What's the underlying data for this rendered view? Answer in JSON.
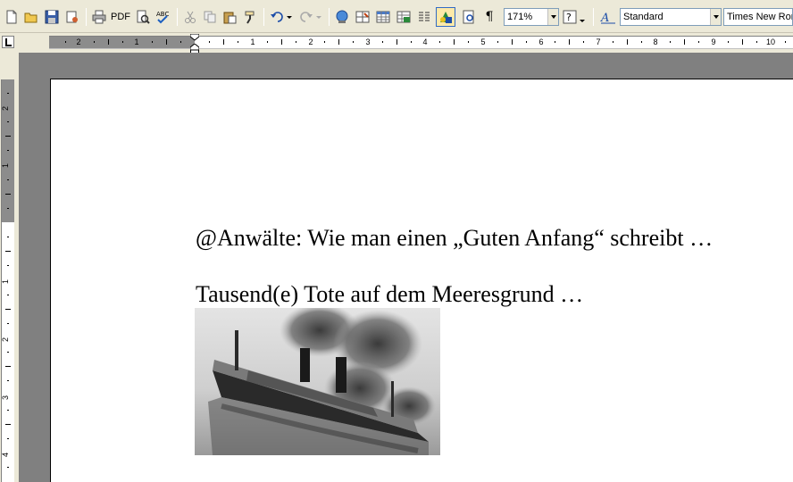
{
  "toolbar": {
    "pdf_label": "PDF",
    "zoom_value": "171%",
    "style_value": "Standard",
    "font_value": "Times New Roman"
  },
  "icons": [
    "new-doc-icon",
    "open-folder-icon",
    "save-icon",
    "permission-icon",
    "print-icon",
    "pdf-icon",
    "print-preview-icon",
    "spellcheck-icon",
    "cut-icon",
    "copy-icon",
    "paste-icon",
    "format-painter-icon",
    "undo-icon",
    "redo-icon",
    "hyperlink-icon",
    "tables-borders-icon",
    "insert-table-icon",
    "insert-excel-icon",
    "columns-icon",
    "drawing-icon",
    "document-map-icon",
    "pilcrow-icon",
    "help-icon",
    "styles-icon"
  ],
  "ruler": {
    "left_numbers": [
      "2",
      "1"
    ],
    "right_numbers": [
      "1",
      "2",
      "3",
      "4",
      "5",
      "6",
      "7",
      "8",
      "9",
      "10"
    ],
    "vertical_numbers": [
      "2",
      "1",
      "1",
      "2",
      "3",
      "4"
    ]
  },
  "document": {
    "line1": "@Anwälte: Wie man einen „Guten Anfang“ schreibt …",
    "line2": "Tausend(e) Tote auf dem Meeresgrund …"
  },
  "colors": {
    "workspace": "#808080",
    "toolbar": "#ece9d8",
    "page": "#ffffff",
    "ruler_margin": "#8c8c8c"
  }
}
